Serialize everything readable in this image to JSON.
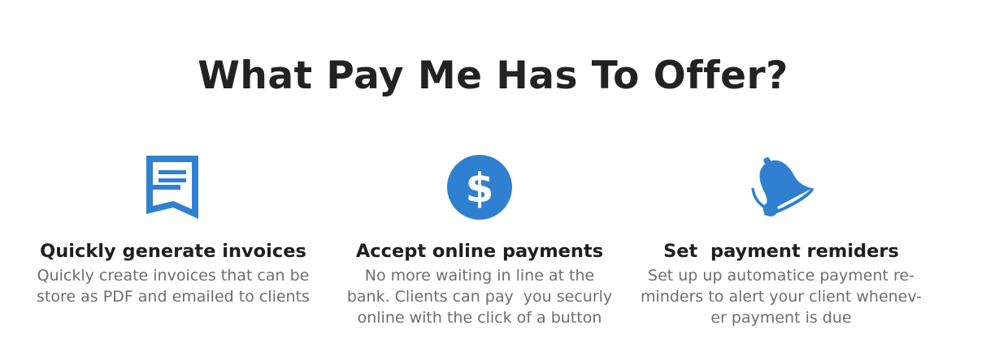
{
  "page": {
    "title": "What Pay Me Has To Offer?"
  },
  "colors": {
    "accent": "#2f80d1",
    "title": "#222222",
    "description": "#6e6e6e"
  },
  "features": [
    {
      "icon": "invoice-icon",
      "heading": "Quickly generate invoices",
      "description_lines": [
        "Quickly create invoices that can be",
        "store as PDF and emailed to clients"
      ]
    },
    {
      "icon": "dollar-icon",
      "heading": "Accept online payments",
      "description_lines": [
        "No more waiting in line at the",
        "bank. Clients can pay  you securly",
        "online with the click of a button"
      ]
    },
    {
      "icon": "bell-icon",
      "heading": "Set  payment remiders",
      "description_lines": [
        "Set up up automatice payment re-",
        "minders to alert your client whenev-",
        "er payment is due"
      ]
    }
  ]
}
